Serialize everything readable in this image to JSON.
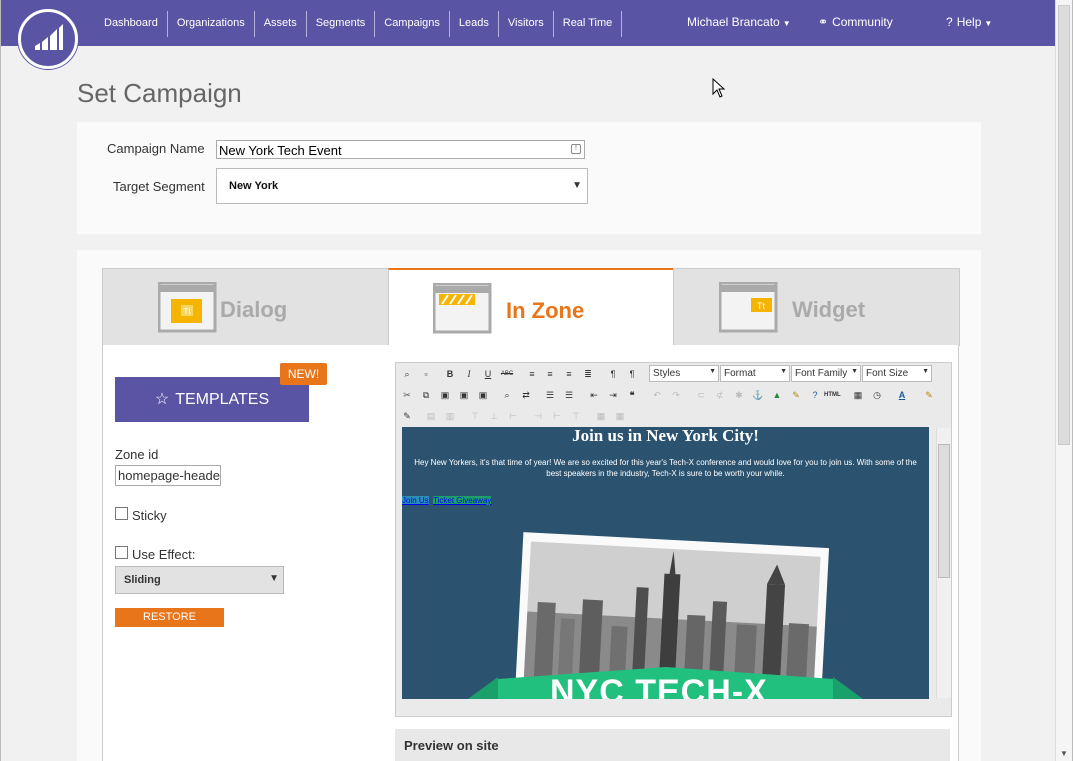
{
  "nav": {
    "items": [
      "Dashboard",
      "Organizations",
      "Assets",
      "Segments",
      "Campaigns",
      "Leads",
      "Visitors",
      "Real Time"
    ],
    "user": "Michael Brancato",
    "community": "Community",
    "help": "Help"
  },
  "page": {
    "title": "Set Campaign"
  },
  "campaign": {
    "name_label": "Campaign Name",
    "name_value": "New York Tech Event",
    "segment_label": "Target Segment",
    "segment_value": "New York"
  },
  "tabs": [
    {
      "label": "Dialog",
      "icon": "dialog-window-icon",
      "active": false
    },
    {
      "label": "In Zone",
      "icon": "in-zone-window-icon",
      "active": true
    },
    {
      "label": "Widget",
      "icon": "widget-window-icon",
      "active": false
    }
  ],
  "options": {
    "templates_label": "TEMPLATES",
    "new_badge": "NEW!",
    "zone_label": "Zone id",
    "zone_value": "homepage-header",
    "sticky_label": "Sticky",
    "effect_label": "Use Effect:",
    "effect_value": "Sliding",
    "restore_label": "RESTORE DEFAULTS"
  },
  "editor": {
    "toolbar_icons_row1": [
      "find-icon",
      "new-page-icon",
      "bold-icon",
      "italic-icon",
      "underline-icon",
      "strikethrough-icon",
      "align-left-icon",
      "align-center-icon",
      "align-right-icon",
      "justify-icon",
      "ltr-icon",
      "rtl-icon"
    ],
    "styles_dropdown": "Styles",
    "format_dropdown": "Format",
    "font_family_dropdown": "Font Family",
    "font_size_dropdown": "Font Size",
    "text_bold": "B",
    "text_italic": "I",
    "text_underline": "U",
    "text_strike": "ABC",
    "html_label": "HTML",
    "content_heading": "Join us in New York City!",
    "content_body": "Hey New Yorkers, it's that time of year! We are so excited for this year's Tech-X conference and would love for you to join us. With some of the best speakers in the industry, Tech-X is sure to be worth your while.",
    "link_join": "Join Us",
    "link_ticket": "Ticket Giveaway",
    "banner_text": "NYC TECH-X"
  },
  "preview": {
    "label": "Preview on site"
  },
  "colors": {
    "brand": "#5a54a4",
    "accent": "#e8751a",
    "editor_bg": "#2b5370"
  }
}
